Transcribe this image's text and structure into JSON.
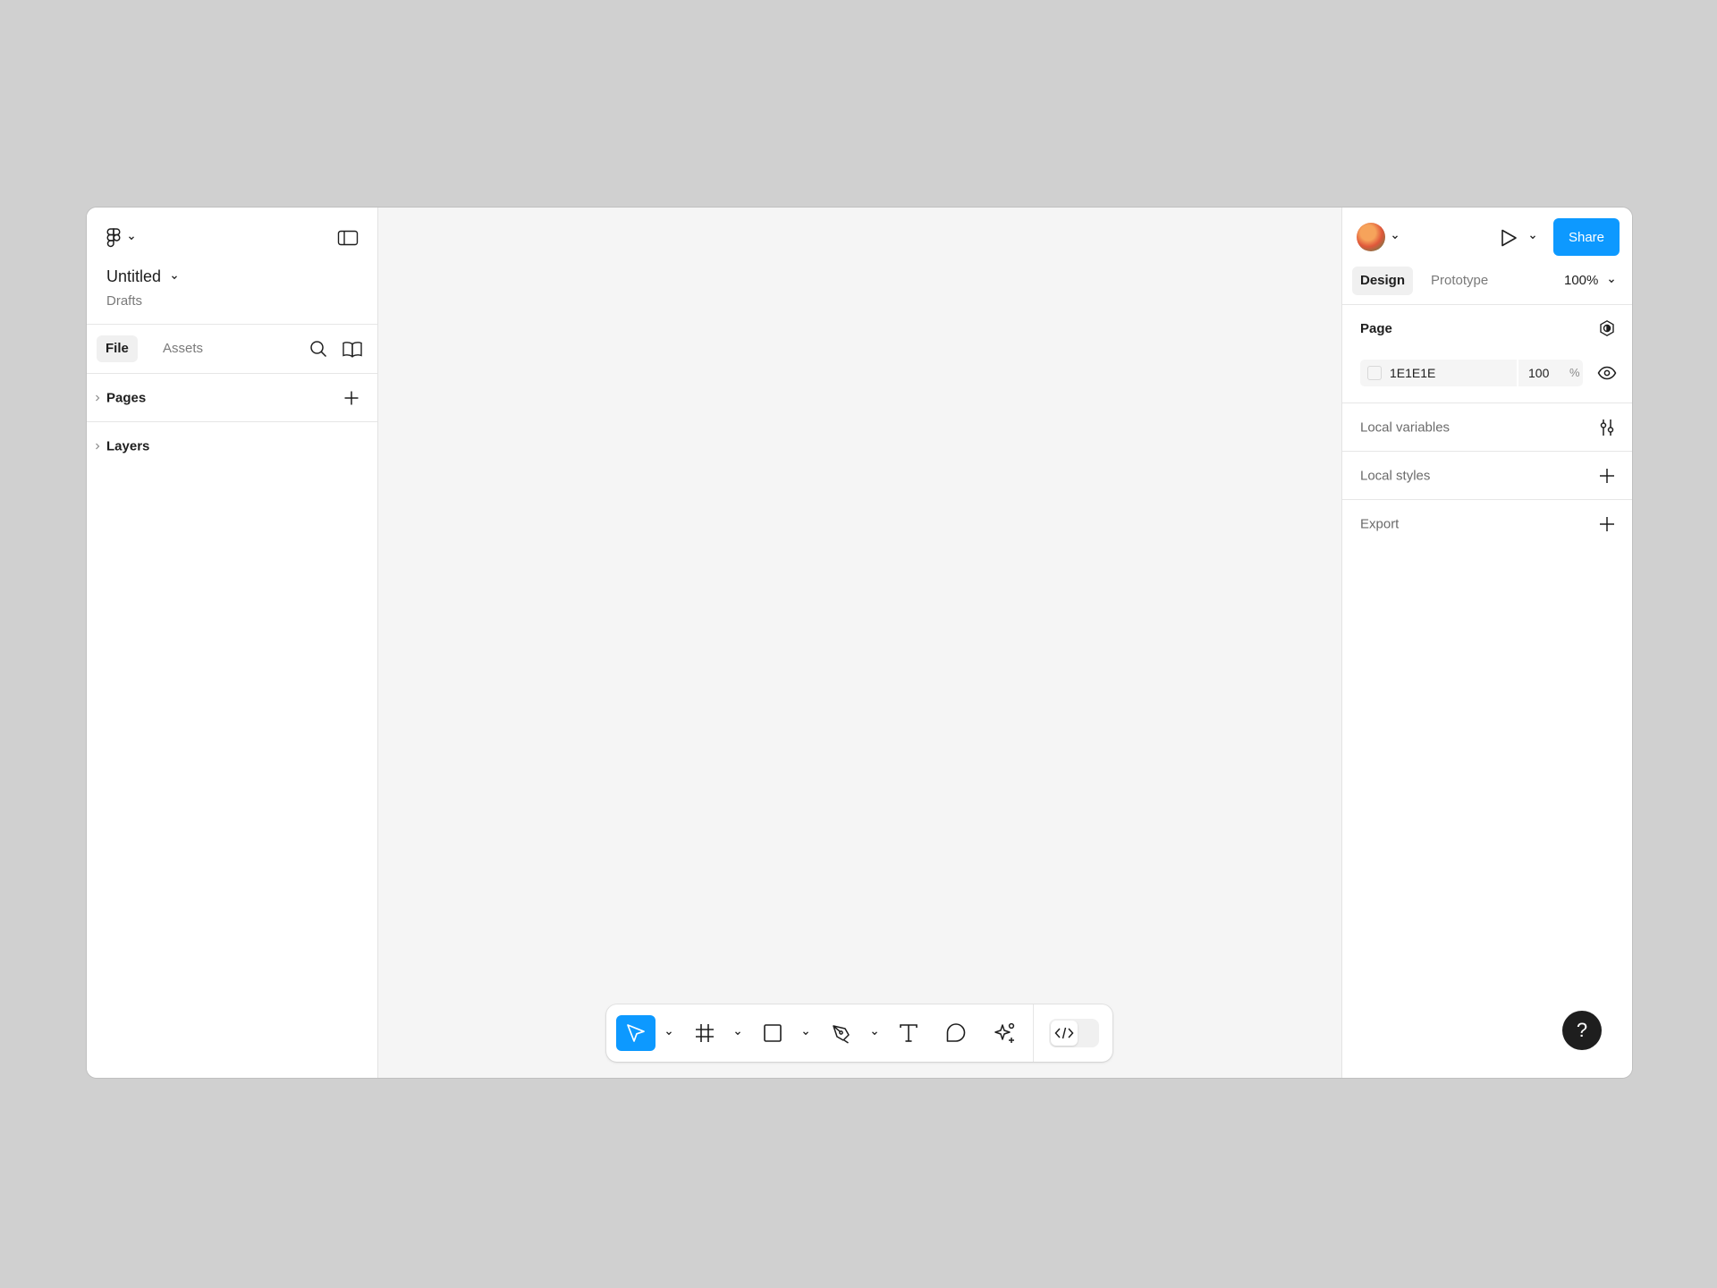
{
  "file": {
    "title": "Untitled",
    "location": "Drafts"
  },
  "left_panel": {
    "tabs": {
      "file": "File",
      "assets": "Assets"
    },
    "sections": {
      "pages": "Pages",
      "layers": "Layers"
    }
  },
  "header": {
    "share_label": "Share"
  },
  "right_panel": {
    "tabs": {
      "design": "Design",
      "prototype": "Prototype"
    },
    "zoom": "100%",
    "page": {
      "title": "Page",
      "background_hex": "1E1E1E",
      "opacity": "100",
      "opacity_unit": "%"
    },
    "local_variables": "Local variables",
    "local_styles": "Local styles",
    "export": "Export",
    "help_label": "?"
  },
  "colors": {
    "accent": "#0d99ff",
    "canvas": "#f5f5f5",
    "panel": "#ffffff",
    "text": "#1e1e1e"
  },
  "toolbar": {
    "tools": [
      "move-tool",
      "frame-tool",
      "rectangle-tool",
      "pen-tool",
      "text-tool",
      "comment-tool",
      "actions-tool",
      "dev-mode-toggle"
    ]
  }
}
